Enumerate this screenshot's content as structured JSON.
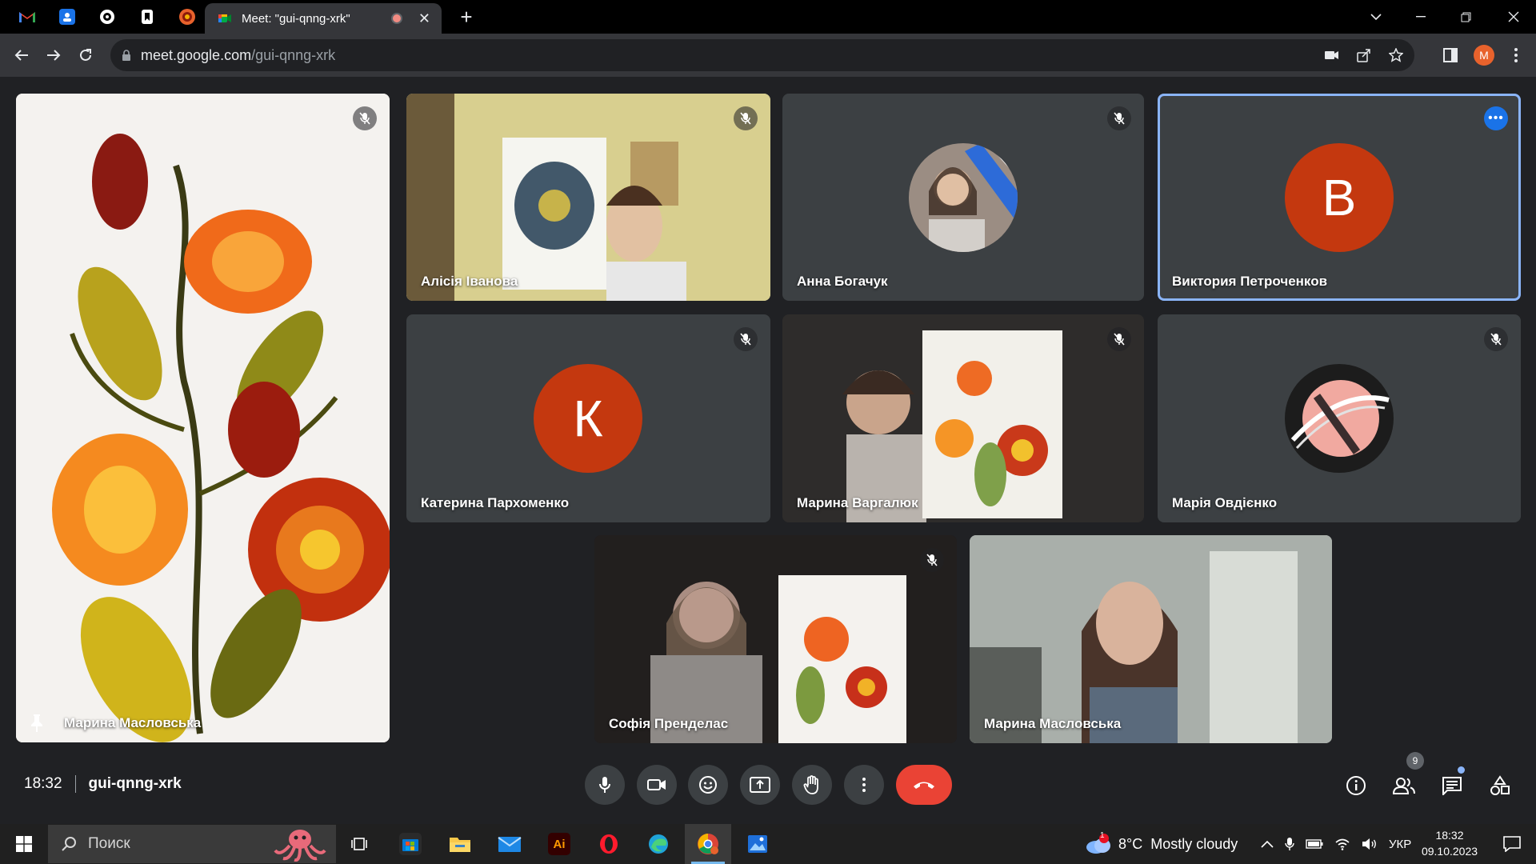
{
  "browser": {
    "active_tab_title": "Meet: \"gui-qnng-xrk\"",
    "url_host": "meet.google.com",
    "url_path": "/gui-qnng-xrk",
    "profile_initial": "M",
    "pinned_tabs": [
      "gmail-icon",
      "contacts-icon",
      "app-icon",
      "bookmark-app-icon",
      "flower-app-icon"
    ]
  },
  "meet": {
    "tiles": [
      {
        "name": "Марина Масловська",
        "kind": "video",
        "pinned": true,
        "muted": true
      },
      {
        "name": "Алісія Іванова",
        "kind": "video",
        "muted": true
      },
      {
        "name": "Анна Богачук",
        "kind": "photo-avatar",
        "muted": true
      },
      {
        "name": "Виктория Петроченков",
        "kind": "letter-avatar",
        "letter": "В",
        "color": "#c4380f",
        "speaking": true
      },
      {
        "name": "Катерина Пархоменко",
        "kind": "letter-avatar",
        "letter": "К",
        "color": "#c4380f",
        "muted": true
      },
      {
        "name": "Марина Варгалюк",
        "kind": "video",
        "muted": true
      },
      {
        "name": "Марія Овдієнко",
        "kind": "photo-avatar",
        "muted": true
      },
      {
        "name": "Софія Пренделас",
        "kind": "video",
        "muted": true
      },
      {
        "name": "Марина Масловська",
        "kind": "video",
        "muted": false
      }
    ],
    "time": "18:32",
    "meeting_code": "gui-qnng-xrk",
    "participants_count": "9"
  },
  "taskbar": {
    "search_placeholder": "Поиск",
    "weather_temp": "8°C",
    "weather_desc": "Mostly cloudy",
    "weather_alert": "1",
    "language": "УКР",
    "clock_time": "18:32",
    "clock_date": "09.10.2023"
  },
  "colors": {
    "accent_blue": "#8ab4f8",
    "hangup_red": "#ea4335",
    "avatar_orange": "#c4380f"
  }
}
